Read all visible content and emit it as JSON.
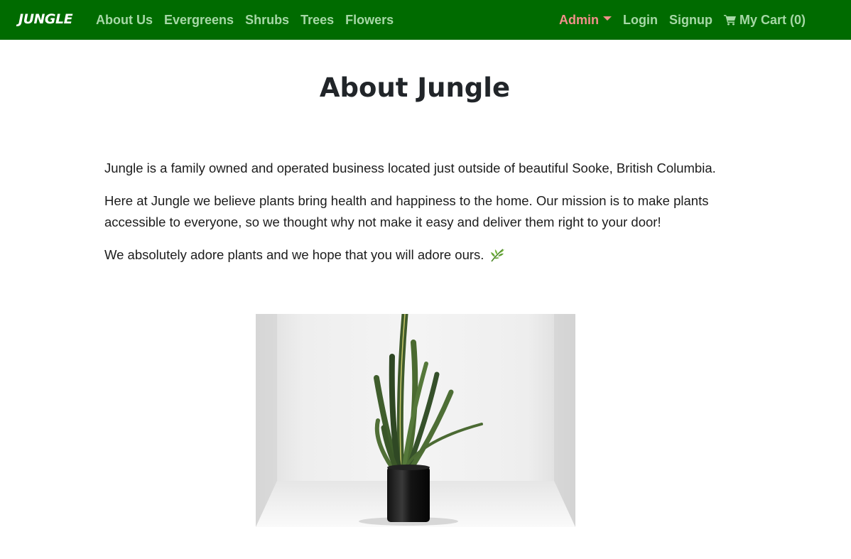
{
  "navbar": {
    "brand": "JUNGLE",
    "left_links": [
      {
        "label": "About Us"
      },
      {
        "label": "Evergreens"
      },
      {
        "label": "Shrubs"
      },
      {
        "label": "Trees"
      },
      {
        "label": "Flowers"
      }
    ],
    "admin_label": "Admin",
    "login_label": "Login",
    "signup_label": "Signup",
    "cart_label": "My Cart (0)",
    "cart_icon": "shopping-cart-icon",
    "admin_dropdown_icon": "caret-down-icon"
  },
  "main": {
    "title": "About Jungle",
    "paragraphs": [
      "Jungle is a family owned and operated business located just outside of beautiful Sooke, British Columbia.",
      "Here at Jungle we believe plants bring health and happiness to the home. Our mission is to make plants accessible to everyone, so we thought why not make it easy and deliver them right to your door!",
      "We absolutely adore plants and we hope that you will adore ours."
    ],
    "leaf_icon": "herb-icon",
    "photo_subject": "snake-plant-photo"
  },
  "colors": {
    "navbar_bg": "#006b00",
    "nav_link": "#a6d8a6",
    "admin_link": "#f1908a",
    "brand": "#ffffff",
    "text": "#212529"
  }
}
